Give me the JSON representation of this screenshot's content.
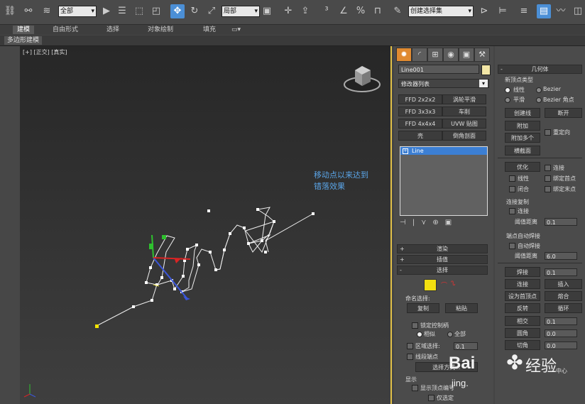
{
  "toolbar": {
    "selection_filter": "全部",
    "ref_coord": "局部",
    "named_selection": "创建选择集"
  },
  "ribbon": {
    "tabs": [
      "建模",
      "自由形式",
      "选择",
      "对象绘制",
      "填充"
    ],
    "sub_label": "多边形建模"
  },
  "viewport": {
    "label": "[+] [正交] [真实]",
    "annotation_line1": "移动点以来达到",
    "annotation_line2": "错落效果"
  },
  "command_panel": {
    "object_name": "Line001",
    "modifier_list": "修改器列表",
    "modifier_buttons": [
      "FFD 2x2x2",
      "涡轮平滑",
      "FFD 3x3x3",
      "车削",
      "FFD 4x4x4",
      "UVW 贴图",
      "壳",
      "倒角剖面"
    ],
    "stack_item": "Line",
    "rollouts": {
      "render": "渲染",
      "interp": "插值",
      "select": "选择"
    },
    "named_sel_label": "命名选择:",
    "copy": "复制",
    "paste": "粘贴",
    "lock_handles": "锁定控制柄",
    "similar": "相似",
    "all": "全部",
    "area_select": "区域选择:",
    "area_value": "0.1",
    "segment_end": "线段端点",
    "select_by": "选择方式...",
    "display": "显示",
    "show_vertex_numbers": "显示顶点编号",
    "selected_only": "仅选定"
  },
  "geometry_panel": {
    "title": "几何体",
    "new_vertex_type": "新顶点类型",
    "linear": "线性",
    "bezier": "Bezier",
    "smooth": "平滑",
    "bezier_corner": "Bezier 角点",
    "create_line": "创建线",
    "break": "断开",
    "attach": "附加",
    "attach_multiple": "附加多个",
    "reorient": "重定向",
    "cross_section": "横截面",
    "refine": "优化",
    "connect": "连接",
    "linear2": "线性",
    "bind_first": "绑定首点",
    "closed": "闭合",
    "bind_last": "绑定末点",
    "connect_copy": "连接复制",
    "connect2": "连接",
    "threshold": "阈值距离",
    "threshold_val": "0.1",
    "end_auto_weld": "端点自动焊接",
    "auto_weld": "自动焊接",
    "threshold2": "阈值距离",
    "threshold2_val": "6.0",
    "weld": "焊接",
    "weld_val": "0.1",
    "connect3": "连接",
    "insert": "插入",
    "make_first": "设为首顶点",
    "fuse": "熔合",
    "reverse": "反转",
    "cycle": "循环",
    "intersect": "相交",
    "intersect_val": "0.1",
    "fillet": "圆角",
    "fillet_val": "0.0",
    "chamfer": "切角",
    "chamfer_val": "0.0",
    "center": "中心"
  },
  "watermark": {
    "brand": "Bai",
    "domain": "jing.",
    "text": "经验"
  }
}
